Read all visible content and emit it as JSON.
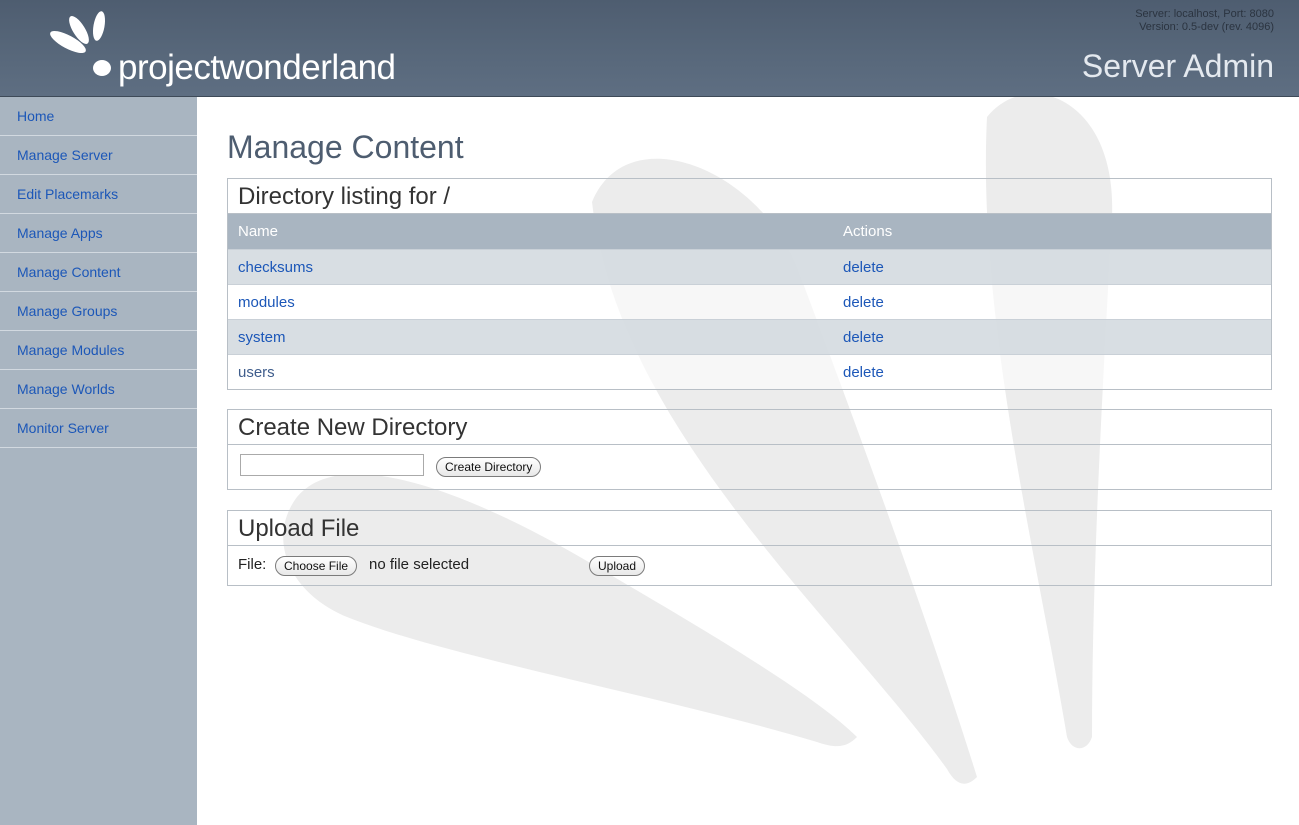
{
  "header": {
    "logo_text": "projectwonderland",
    "server_line": "Server: localhost, Port: 8080",
    "version_line": "Version: 0.5-dev (rev. 4096)",
    "title": "Server Admin"
  },
  "sidebar": {
    "items": [
      {
        "label": "Home"
      },
      {
        "label": "Manage Server"
      },
      {
        "label": "Edit Placemarks"
      },
      {
        "label": "Manage Apps"
      },
      {
        "label": "Manage Content"
      },
      {
        "label": "Manage Groups"
      },
      {
        "label": "Manage Modules"
      },
      {
        "label": "Manage Worlds"
      },
      {
        "label": "Monitor Server"
      }
    ]
  },
  "main": {
    "page_title": "Manage Content",
    "listing": {
      "title": "Directory listing for /",
      "columns": [
        "Name",
        "Actions"
      ],
      "rows": [
        {
          "name": "checksums",
          "action": "delete"
        },
        {
          "name": "modules",
          "action": "delete"
        },
        {
          "name": "system",
          "action": "delete"
        },
        {
          "name": "users",
          "action": "delete"
        }
      ]
    },
    "create_dir": {
      "title": "Create New Directory",
      "input_value": "",
      "button_label": "Create Directory"
    },
    "upload": {
      "title": "Upload File",
      "file_label": "File:",
      "choose_label": "Choose File",
      "no_file_text": "no file selected",
      "upload_label": "Upload"
    }
  },
  "colors": {
    "header_bg": "#58687b",
    "sidebar_bg": "#a9b5c1",
    "link": "#1c57b8",
    "table_header_bg": "#a9b5c1",
    "title": "#4e5d70"
  }
}
